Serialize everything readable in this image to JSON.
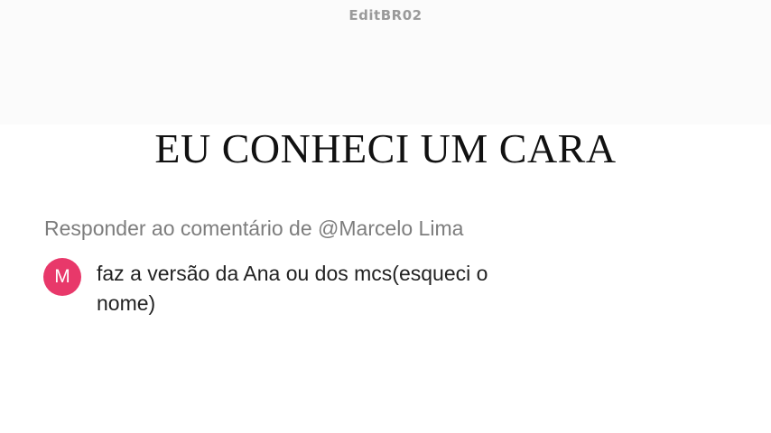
{
  "watermark": "EditBR02",
  "headline": "EU CONHECI UM CARA",
  "reply_header": "Responder ao comentário de @Marcelo Lima",
  "comment": {
    "avatar_letter": "M",
    "avatar_color": "#e8386a",
    "text": "faz a versão da Ana ou dos mcs(esqueci o nome)"
  }
}
